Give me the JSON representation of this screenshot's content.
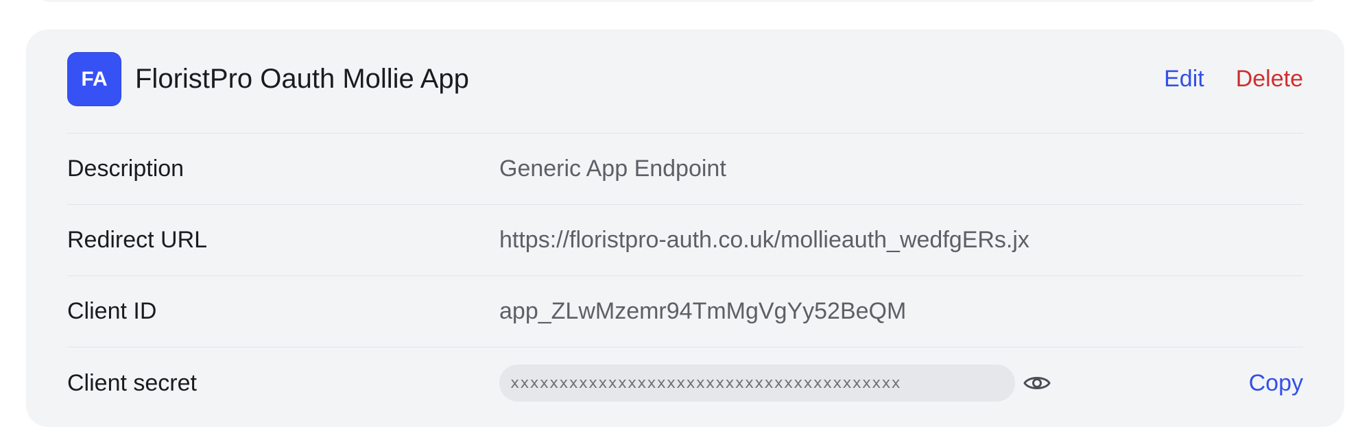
{
  "app": {
    "avatar_initials": "FA",
    "title": "FloristPro Oauth Mollie App",
    "edit_label": "Edit",
    "delete_label": "Delete"
  },
  "details": {
    "description_label": "Description",
    "description_value": "Generic App Endpoint",
    "redirect_label": "Redirect URL",
    "redirect_value": "https://floristpro-auth.co.uk/mollieauth_wedfgERs.jx",
    "client_id_label": "Client ID",
    "client_id_value": "app_ZLwMzemr94TmMgVgYy52BeQM",
    "client_secret_label": "Client secret",
    "client_secret_masked": "xxxxxxxxxxxxxxxxxxxxxxxxxxxxxxxxxxxxxxxx",
    "copy_label": "Copy"
  },
  "icons": {
    "reveal": "eye-icon"
  },
  "colors": {
    "accent": "#3350e6",
    "danger": "#cf2f2f",
    "avatar_bg": "#3652f5",
    "card_bg": "#f3f4f6"
  }
}
